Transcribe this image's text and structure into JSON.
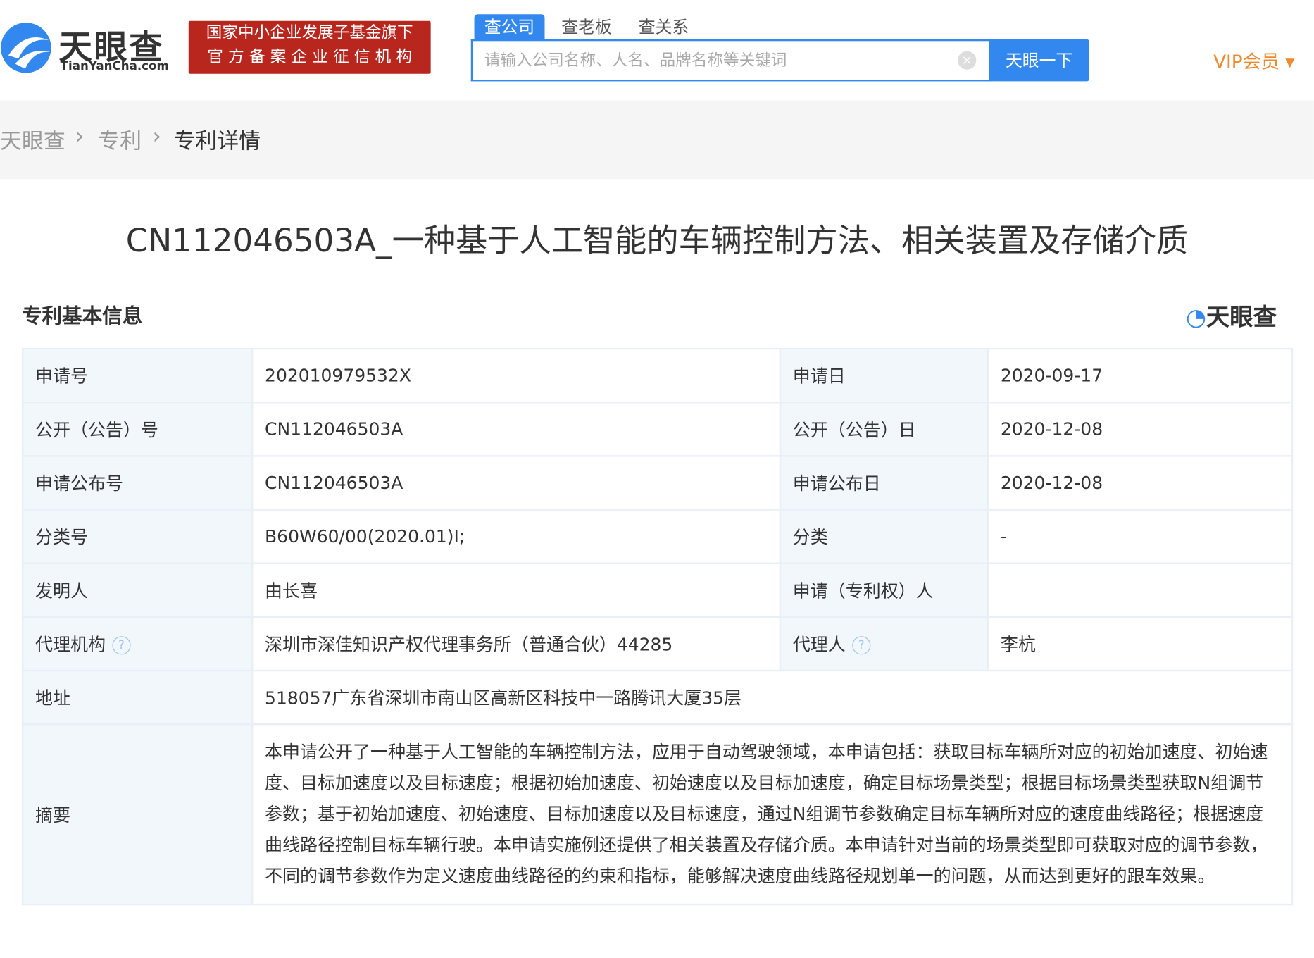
{
  "header": {
    "logo_text": "天眼查",
    "logo_sub": "TianYanCha.com",
    "badge_line1": "国家中小企业发展子基金旗下",
    "badge_line2": "官 方 备 案 企 业 征 信 机 构",
    "search_tabs": [
      "查公司",
      "查老板",
      "查关系"
    ],
    "search_placeholder": "请输入公司名称、人名、品牌名称等关键词",
    "search_button": "天眼一下",
    "vip": "VIP会员 ▾"
  },
  "breadcrumb": [
    "天眼查",
    "专利",
    "专利详情"
  ],
  "title": "CN112046503A_一种基于人工智能的车辆控制方法、相关装置及存储介质",
  "section": {
    "title": "专利基本信息",
    "logo": "天眼查"
  },
  "rows": [
    {
      "l1": "申请号",
      "v1": "202010979532X",
      "l2": "申请日",
      "v2": "2020-09-17"
    },
    {
      "l1": "公开（公告）号",
      "v1": "CN112046503A",
      "l2": "公开（公告）日",
      "v2": "2020-12-08"
    },
    {
      "l1": "申请公布号",
      "v1": "CN112046503A",
      "l2": "申请公布日",
      "v2": "2020-12-08"
    },
    {
      "l1": "分类号",
      "v1": "B60W60/00(2020.01)I;",
      "l2": "分类",
      "v2": "-"
    },
    {
      "l1": "发明人",
      "v1": "由长喜",
      "l2": "申请（专利权）人",
      "v2": ""
    },
    {
      "l1": "代理机构",
      "v1": "深圳市深佳知识产权代理事务所（普通合伙）44285",
      "l2": "代理人",
      "v2": "李杭"
    }
  ],
  "address": {
    "label": "地址",
    "value": "518057广东省深圳市南山区高新区科技中一路腾讯大厦35层"
  },
  "abstract": {
    "label": "摘要",
    "value": "本申请公开了一种基于人工智能的车辆控制方法，应用于自动驾驶领域，本申请包括：获取目标车辆所对应的初始加速度、初始速度、目标加速度以及目标速度；根据初始加速度、初始速度以及目标加速度，确定目标场景类型；根据目标场景类型获取N组调节参数；基于初始加速度、初始速度、目标加速度以及目标速度，通过N组调节参数确定目标车辆所对应的速度曲线路径；根据速度曲线路径控制目标车辆行驶。本申请实施例还提供了相关装置及存储介质。本申请针对当前的场景类型即可获取对应的调节参数，不同的调节参数作为定义速度曲线路径的约束和指标，能够解决速度曲线路径规划单一的问题，从而达到更好的跟车效果。"
  },
  "help_icon": "?",
  "colors": {
    "brand_blue": "#3388f0",
    "badge_red": "#b8261e",
    "vip_orange": "#f08a2c"
  }
}
